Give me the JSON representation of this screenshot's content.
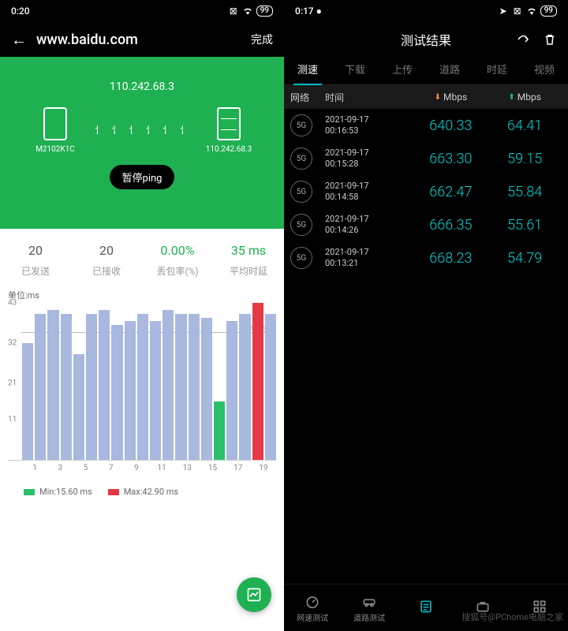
{
  "left": {
    "status": {
      "time": "0:20",
      "battery": "99"
    },
    "header": {
      "url": "www.baidu.com",
      "done": "完成"
    },
    "ip": "110.242.68.3",
    "device_phone": "M2102K1C",
    "device_server": "110.242.68.3",
    "pause_btn": "暂停ping",
    "stats": {
      "sent": {
        "v": "20",
        "l": "已发送"
      },
      "recv": {
        "v": "20",
        "l": "已接收"
      },
      "loss": {
        "v": "0.00%",
        "l": "丢包率(%)"
      },
      "avg": {
        "v": "35 ms",
        "l": "平均时延"
      }
    },
    "chart_unit": "单位:ms",
    "avg_label": "平均时延",
    "legend_min": "Min:15.60 ms",
    "legend_max": "Max:42.90 ms"
  },
  "right": {
    "status": {
      "time": "0:17",
      "battery": "99"
    },
    "title": "测试结果",
    "tabs": [
      "测速",
      "下载",
      "上传",
      "道路",
      "时延",
      "视频"
    ],
    "thead": {
      "net": "网络",
      "time": "时间",
      "down": "Mbps",
      "up": "Mbps"
    },
    "rows": [
      {
        "net": "5G",
        "date": "2021-09-17",
        "time": "00:16:53",
        "down": "640.33",
        "up": "64.41"
      },
      {
        "net": "5G",
        "date": "2021-09-17",
        "time": "00:15:28",
        "down": "663.30",
        "up": "59.15"
      },
      {
        "net": "5G",
        "date": "2021-09-17",
        "time": "00:14:58",
        "down": "662.47",
        "up": "55.84"
      },
      {
        "net": "5G",
        "date": "2021-09-17",
        "time": "00:14:26",
        "down": "666.35",
        "up": "55.61"
      },
      {
        "net": "5G",
        "date": "2021-09-17",
        "time": "00:13:21",
        "down": "668.23",
        "up": "54.79"
      }
    ],
    "bottom_tabs": [
      "网速测试",
      "道路测试",
      "",
      "",
      ""
    ]
  },
  "watermark": "搜狐号@PChome电脑之家",
  "chart_data": {
    "type": "bar",
    "unit": "ms",
    "ylim": [
      0,
      43
    ],
    "yticks": [
      11,
      21,
      32,
      43
    ],
    "xticks": [
      1,
      3,
      5,
      7,
      9,
      11,
      13,
      15,
      17,
      19
    ],
    "average": 35,
    "bars": [
      {
        "v": 32,
        "c": "n"
      },
      {
        "v": 40,
        "c": "n"
      },
      {
        "v": 41,
        "c": "n"
      },
      {
        "v": 40,
        "c": "n"
      },
      {
        "v": 29,
        "c": "n"
      },
      {
        "v": 40,
        "c": "n"
      },
      {
        "v": 41,
        "c": "n"
      },
      {
        "v": 37,
        "c": "n"
      },
      {
        "v": 38,
        "c": "n"
      },
      {
        "v": 40,
        "c": "n"
      },
      {
        "v": 38,
        "c": "n"
      },
      {
        "v": 41,
        "c": "n"
      },
      {
        "v": 40,
        "c": "n"
      },
      {
        "v": 40,
        "c": "n"
      },
      {
        "v": 39,
        "c": "n"
      },
      {
        "v": 16,
        "c": "g"
      },
      {
        "v": 38,
        "c": "n"
      },
      {
        "v": 40,
        "c": "n"
      },
      {
        "v": 43,
        "c": "r"
      },
      {
        "v": 40,
        "c": "n"
      }
    ],
    "min": 15.6,
    "max": 42.9
  }
}
